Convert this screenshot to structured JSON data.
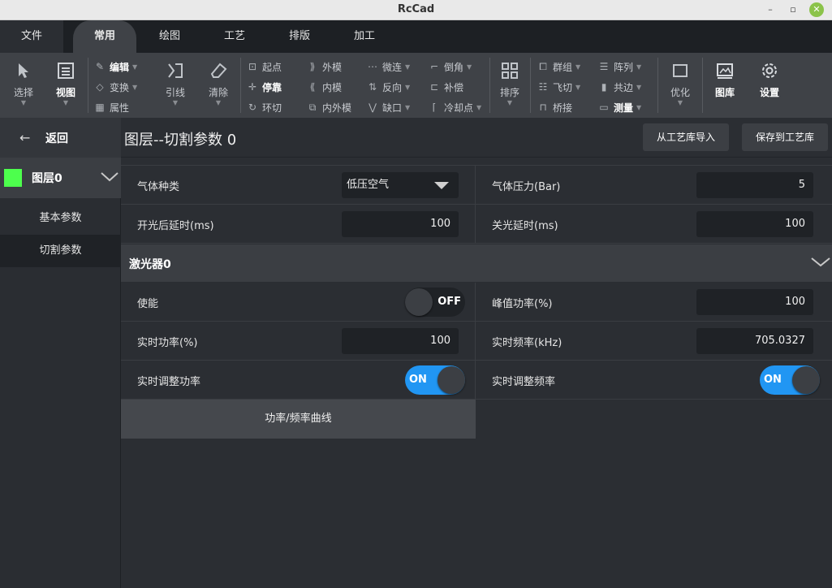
{
  "window": {
    "title": "RcCad",
    "min": "–",
    "max": "▫",
    "close": "✕"
  },
  "menu": {
    "tabs": [
      "文件",
      "常用",
      "绘图",
      "工艺",
      "排版",
      "加工"
    ]
  },
  "ribbon": {
    "select": "选择",
    "view": "视图",
    "edit": "编辑",
    "transform": "变换",
    "attr": "属性",
    "leadline": "引线",
    "clear": "清除",
    "start_point": "起点",
    "stop": "停靠",
    "loop_cut": "环切",
    "outer_mold": "外模",
    "inner_mold": "内模",
    "inner_outer_mold": "内外模",
    "micro_joint": "微连",
    "reverse": "反向",
    "gap": "缺口",
    "chamfer": "倒角",
    "compensate": "补偿",
    "cooling_point": "冷却点",
    "sort": "排序",
    "group": "群组",
    "fly_cut": "飞切",
    "bridge": "桥接",
    "array": "阵列",
    "common_edge": "共边",
    "measure": "测量",
    "optimize": "优化",
    "library": "图库",
    "settings": "设置"
  },
  "sidebar": {
    "back": "返回",
    "layer_name": "图层0",
    "layer_color": "#4dff4d",
    "items": [
      "基本参数",
      "切割参数"
    ]
  },
  "header": {
    "title": "图层--切割参数 0",
    "import_btn": "从工艺库导入",
    "save_btn": "保存到工艺库"
  },
  "params": {
    "gas_type_label": "气体种类",
    "gas_type_value": "低压空气",
    "gas_pressure_label": "气体压力(Bar)",
    "gas_pressure_value": "5",
    "on_delay_label": "开光后延时(ms)",
    "on_delay_value": "100",
    "off_delay_label": "关光延时(ms)",
    "off_delay_value": "100"
  },
  "laser": {
    "section_title": "激光器0",
    "enable_label": "使能",
    "enable_state": "OFF",
    "peak_power_label": "峰值功率(%)",
    "peak_power_value": "100",
    "realtime_power_label": "实时功率(%)",
    "realtime_power_value": "100",
    "realtime_freq_label": "实时频率(kHz)",
    "realtime_freq_value": "705.0327",
    "adj_power_label": "实时调整功率",
    "adj_power_state": "ON",
    "adj_freq_label": "实时调整频率",
    "adj_freq_state": "ON",
    "curve_button": "功率/频率曲线"
  }
}
